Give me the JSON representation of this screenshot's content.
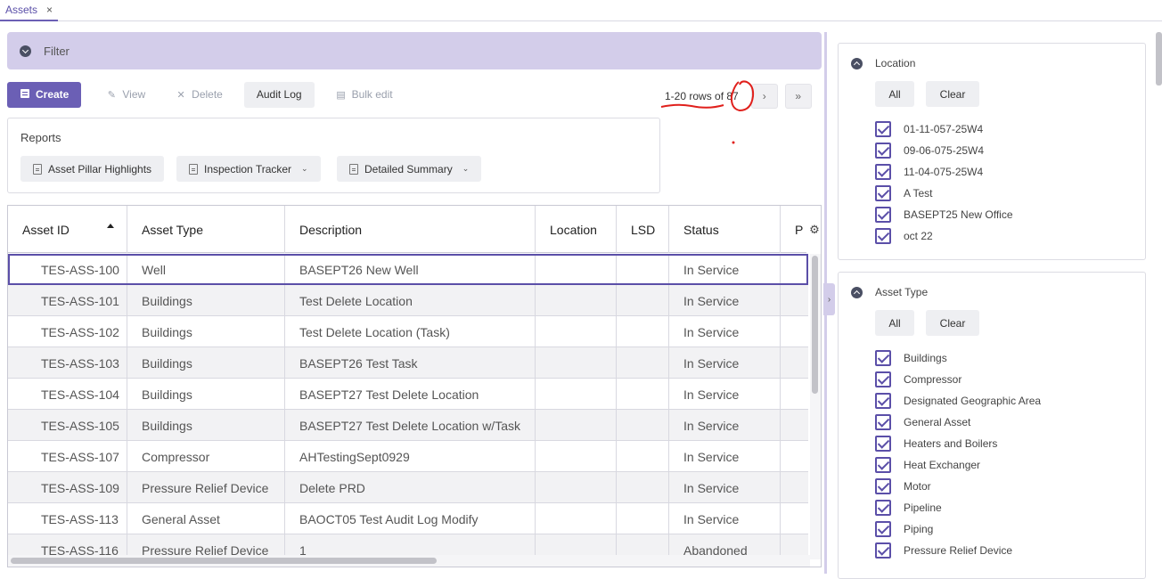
{
  "tab": {
    "label": "Assets",
    "close": "×"
  },
  "filter": {
    "label": "Filter"
  },
  "toolbar": {
    "create": "Create",
    "view": "View",
    "delete": "Delete",
    "audit_log": "Audit Log",
    "bulk_edit": "Bulk edit"
  },
  "pager": {
    "range": "1-20 rows of",
    "total": "87",
    "next": "›",
    "last": "»"
  },
  "reports": {
    "title": "Reports",
    "items": [
      "Asset Pillar Highlights",
      "Inspection Tracker",
      "Detailed Summary"
    ]
  },
  "grid": {
    "columns": [
      "Asset ID",
      "Asset Type",
      "Description",
      "Location",
      "LSD",
      "Status",
      "P"
    ],
    "rows": [
      {
        "id": "TES-ASS-100",
        "type": "Well",
        "desc": "BASEPT26 New Well",
        "loc": "",
        "lsd": "",
        "status": "In Service"
      },
      {
        "id": "TES-ASS-101",
        "type": "Buildings",
        "desc": "Test Delete Location",
        "loc": "",
        "lsd": "",
        "status": "In Service"
      },
      {
        "id": "TES-ASS-102",
        "type": "Buildings",
        "desc": "Test Delete Location (Task)",
        "loc": "",
        "lsd": "",
        "status": "In Service"
      },
      {
        "id": "TES-ASS-103",
        "type": "Buildings",
        "desc": "BASEPT26 Test Task",
        "loc": "",
        "lsd": "",
        "status": "In Service"
      },
      {
        "id": "TES-ASS-104",
        "type": "Buildings",
        "desc": "BASEPT27 Test Delete Location",
        "loc": "",
        "lsd": "",
        "status": "In Service"
      },
      {
        "id": "TES-ASS-105",
        "type": "Buildings",
        "desc": "BASEPT27 Test Delete Location w/Task",
        "loc": "",
        "lsd": "",
        "status": "In Service"
      },
      {
        "id": "TES-ASS-107",
        "type": "Compressor",
        "desc": "AHTestingSept0929",
        "loc": "",
        "lsd": "",
        "status": "In Service"
      },
      {
        "id": "TES-ASS-109",
        "type": "Pressure Relief Device",
        "desc": "Delete PRD",
        "loc": "",
        "lsd": "",
        "status": "In Service"
      },
      {
        "id": "TES-ASS-113",
        "type": "General Asset",
        "desc": "BAOCT05 Test Audit Log Modify",
        "loc": "",
        "lsd": "",
        "status": "In Service"
      },
      {
        "id": "TES-ASS-116",
        "type": "Pressure Relief Device",
        "desc": "1",
        "loc": "",
        "lsd": "",
        "status": "Abandoned"
      }
    ]
  },
  "location_panel": {
    "title": "Location",
    "all": "All",
    "clear": "Clear",
    "items": [
      "01-11-057-25W4",
      "09-06-075-25W4",
      "11-04-075-25W4",
      "A Test",
      "BASEPT25 New Office",
      "oct 22"
    ]
  },
  "asset_type_panel": {
    "title": "Asset Type",
    "all": "All",
    "clear": "Clear",
    "items": [
      "Buildings",
      "Compressor",
      "Designated Geographic Area",
      "General Asset",
      "Heaters and Boilers",
      "Heat Exchanger",
      "Motor",
      "Pipeline",
      "Piping",
      "Pressure Relief Device"
    ]
  },
  "colors": {
    "accent": "#6b5fb5",
    "filter_bg": "#d3cdea",
    "annotation": "#e0201c"
  }
}
